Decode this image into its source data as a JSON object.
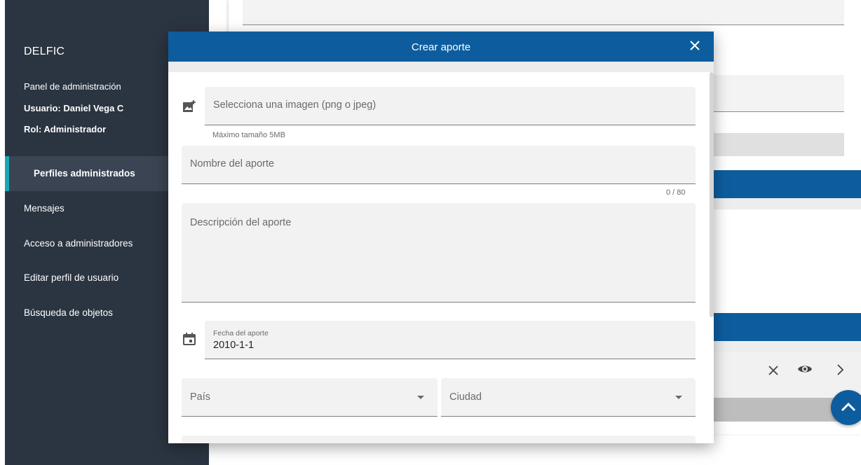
{
  "sidebar": {
    "brand": "DELFIC",
    "panel_label": "Panel de administración",
    "user_label": "Usuario: Daniel Vega C",
    "role_label": "Rol: Administrador",
    "items": [
      {
        "label": "Perfiles administrados",
        "active": true
      },
      {
        "label": "Mensajes"
      },
      {
        "label": "Acceso a administradores"
      },
      {
        "label": "Editar perfil de usuario"
      },
      {
        "label": "Búsqueda de objetos"
      }
    ]
  },
  "dialog": {
    "title": "Crear aporte",
    "close_icon": "close-icon",
    "image_field": {
      "placeholder": "Selecciona una imagen (png o jpeg)",
      "icon": "add-photo-icon",
      "hint": "Máximo tamaño 5MB"
    },
    "name_field": {
      "placeholder": "Nombre del aporte",
      "counter": "0 / 80"
    },
    "description_field": {
      "placeholder": "Descripción del aporte"
    },
    "date_field": {
      "label": "Fecha del aporte",
      "value": "2010-1-1",
      "icon": "calendar-icon"
    },
    "country_select": {
      "placeholder": "País"
    },
    "city_select": {
      "placeholder": "Ciudad"
    }
  },
  "colors": {
    "sidebar_bg": "#2b3441",
    "accent_blue": "#0d5d9e",
    "active_indicator": "#1aa6b5"
  }
}
